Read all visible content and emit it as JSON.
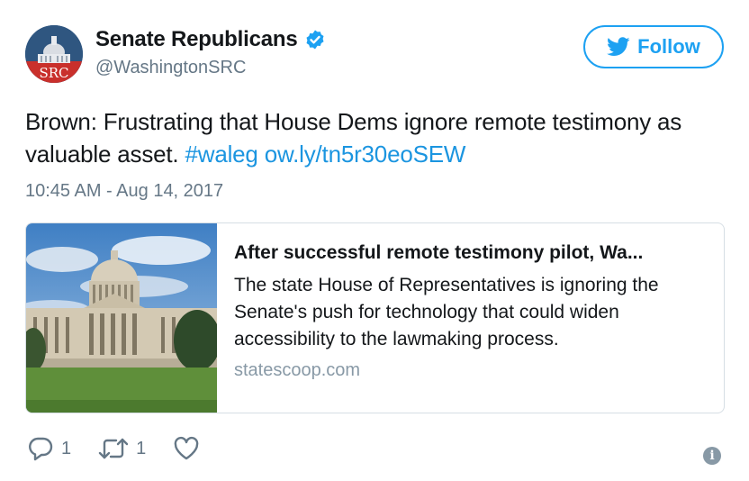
{
  "account": {
    "display_name": "Senate Republicans",
    "handle": "@WashingtonSRC",
    "verified": true,
    "avatar_text": "SRC"
  },
  "follow_button": {
    "label": "Follow",
    "icon": "twitter-bird-icon"
  },
  "tweet": {
    "text_prefix": "Brown: Frustrating that House Dems ignore remote testimony as valuable asset.",
    "hashtag": "#waleg",
    "link": "ow.ly/tn5r30eoSEW",
    "timestamp": "10:45 AM - Aug 14, 2017"
  },
  "card": {
    "title": "After successful remote testimony pilot, Wa...",
    "description": "The state House of Representatives is ignoring the Senate's push for technology that could widen accessibility to the lawmaking process.",
    "domain": "statescoop.com"
  },
  "actions": {
    "reply_count": "1",
    "retweet_count": "1",
    "like_count": ""
  },
  "colors": {
    "accent": "#1da1f2",
    "link": "#1b95e0",
    "muted": "#657786"
  }
}
